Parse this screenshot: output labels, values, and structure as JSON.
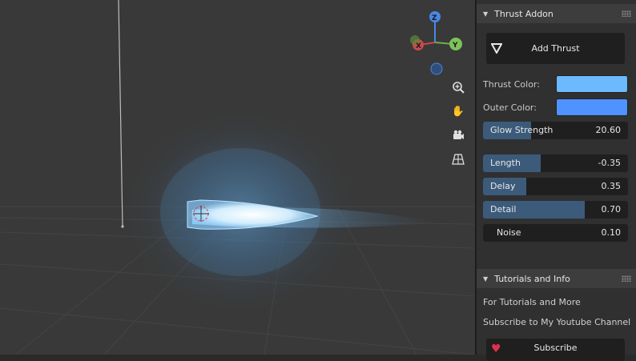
{
  "viewport": {
    "gizmo": {
      "z": "Z",
      "y": "Y",
      "x": "X"
    },
    "nav_icons": [
      "zoom-icon",
      "hand-pan-icon",
      "camera-icon",
      "grid-perspective-icon"
    ]
  },
  "thrust_panel": {
    "title": "Thrust Addon",
    "add_button": "Add Thrust",
    "thrust_color": {
      "label": "Thrust Color:",
      "color": "#6cb9ff"
    },
    "outer_color": {
      "label": "Outer Color:",
      "color": "#4e93ff"
    },
    "sliders": [
      {
        "name": "Glow Strength",
        "value": "20.60",
        "fill": 0.33
      },
      {
        "name": "Length",
        "value": "-0.35",
        "fill": 0.4
      },
      {
        "name": "Delay",
        "value": "0.35",
        "fill": 0.3
      },
      {
        "name": "Detail",
        "value": "0.70",
        "fill": 0.7
      },
      {
        "name": "Noise",
        "value": "0.10",
        "fill": 0.0
      }
    ]
  },
  "tutorials_panel": {
    "title": "Tutorials and Info",
    "line1": "For Tutorials and More",
    "line2": "Subscribe to My Youtube Channel",
    "subscribe_button": "Subscribe"
  }
}
